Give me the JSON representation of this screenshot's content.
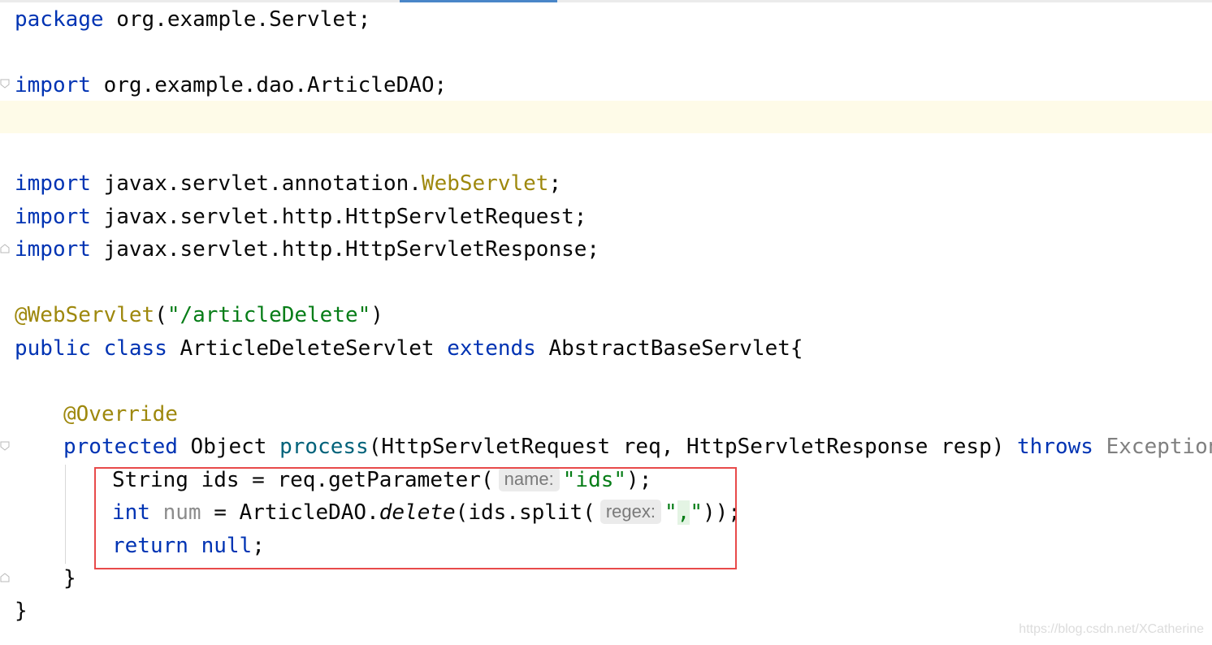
{
  "editor": {
    "code": {
      "line1": {
        "kw": "package",
        "rest": " org.example.Servlet;"
      },
      "line2": {
        "kw": "import",
        "rest": " org.example.dao.ArticleDAO;"
      },
      "line3": {
        "kw": "import",
        "pre": " javax.servlet.annotation.",
        "ann": "WebServlet",
        "post": ";"
      },
      "line4": {
        "kw": "import",
        "rest": " javax.servlet.http.HttpServletRequest;"
      },
      "line5": {
        "kw": "import",
        "rest": " javax.servlet.http.HttpServletResponse;"
      },
      "line6": {
        "ann": "@WebServlet",
        "open": "(",
        "str": "\"/articleDelete\"",
        "close": ")"
      },
      "line7": {
        "kw1": "public",
        "kw2": "class",
        "name": " ArticleDeleteServlet ",
        "kw3": "extends",
        "rest": " AbstractBaseServlet{"
      },
      "line8": {
        "ann": "@Override"
      },
      "line9": {
        "kw": "protected",
        "t1": " Object ",
        "method": "process",
        "t2": "(HttpServletRequest req, HttpServletResponse resp) ",
        "kw2": "throws",
        "exc": " Exception",
        "t3": " {"
      },
      "line10": {
        "pre": "String ids = req.getParameter(",
        "hint": "name:",
        "str": "\"ids\"",
        "post": ");"
      },
      "line11": {
        "kw": "int",
        "var": " num",
        "t1": " = ArticleDAO.",
        "method": "delete",
        "t2": "(ids.split(",
        "hint": "regex:",
        "q1": "\"",
        "comma": ",",
        "q2": "\"",
        "post": "));"
      },
      "line12": {
        "kw1": "return",
        "kw2": " null",
        "post": ";"
      },
      "line13": {
        "text": "}"
      },
      "line14": {
        "text": "}"
      }
    },
    "watermark": "https://blog.csdn.net/XCatherine"
  },
  "colors": {
    "keyword": "#0033b3",
    "annotation": "#9e880d",
    "string": "#067d17",
    "highlight_box": "#e84a4a",
    "caret_line": "#fefbe8"
  }
}
